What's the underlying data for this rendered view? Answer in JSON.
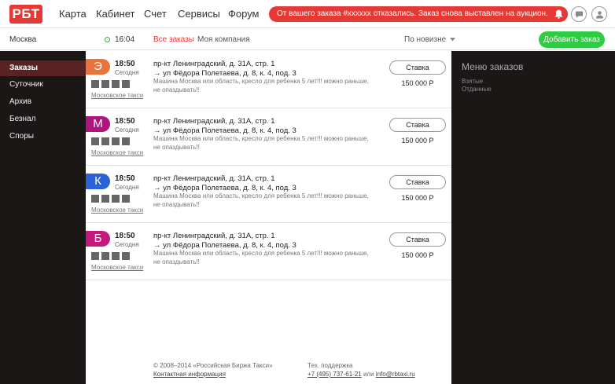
{
  "logo": "РБТ",
  "nav": [
    "Карта",
    "Кабинет",
    "Счет",
    "Сервисы",
    "Форум"
  ],
  "alert": "От вашего заказа #xxxxxx отказались. Заказ снова выставлен на аукцион.",
  "subbar": {
    "city": "Москва",
    "time": "16:04",
    "tab_all": "Все заказы",
    "tab_company": "Моя компания",
    "sort": "По новизне",
    "add_button": "Добавить заказ"
  },
  "sidebar": {
    "items": [
      {
        "label": "Заказы"
      },
      {
        "label": "Суточник"
      },
      {
        "label": "Архив"
      },
      {
        "label": "Безнал"
      },
      {
        "label": "Споры"
      }
    ]
  },
  "orders": [
    {
      "letter": "Э",
      "color": "#e8743b",
      "time": "18:50",
      "day": "Сегодня",
      "company": "Московское такси",
      "from": "пр-кт Ленинградский, д. 31А, стр. 1",
      "to": "→ ул Фёдора Полетаева, д. 8, к. 4, под. 3",
      "note": "Машина Москва или область, кресло для ребенка 5 лет!!! можно раньше, не опаздывать!!",
      "bid": "Ставка",
      "price": "150 000 Р"
    },
    {
      "letter": "М",
      "color": "#b0157e",
      "time": "18:50",
      "day": "Сегодня",
      "company": "Московское такси",
      "from": "пр-кт Ленинградский, д. 31А, стр. 1",
      "to": "→ ул Фёдора Полетаева, д. 8, к. 4, под. 3",
      "note": "Машина Москва или область, кресло для ребенка 5 лет!!! можно раньше, не опаздывать!!",
      "bid": "Ставка",
      "price": "150 000 Р"
    },
    {
      "letter": "К",
      "color": "#2a63d6",
      "time": "18:50",
      "day": "Сегодня",
      "company": "Московское такси",
      "from": "пр-кт Ленинградский, д. 31А, стр. 1",
      "to": "→ ул Фёдора Полетаева, д. 8, к. 4, под. 3",
      "note": "Машина Москва или область, кресло для ребенка 5 лет!!! можно раньше, не опаздывать!!",
      "bid": "Ставка",
      "price": "150 000 Р"
    },
    {
      "letter": "Б",
      "color": "#c4197d",
      "time": "18:50",
      "day": "Сегодня",
      "company": "Московское такси",
      "from": "пр-кт Ленинградский, д. 31А, стр. 1",
      "to": "→ ул Фёдора Полетаева, д. 8, к. 4, под. 3",
      "note": "Машина Москва или область, кресло для ребенка 5 лет!!! можно раньше, не опаздывать!!",
      "bid": "Ставка",
      "price": "150 000 Р"
    }
  ],
  "right_panel": {
    "title": "Меню заказов",
    "items": [
      "Взятые",
      "Отданные"
    ]
  },
  "footer": {
    "copyright": "© 2008–2014 «Российская Биржа Такси»",
    "contacts": "Контактная информация",
    "support": "Тех. поддержка",
    "phone": "+7 (495) 737-61-21",
    "or": "или",
    "email": "info@rbtaxi.ru"
  },
  "colors": {
    "accent": "#e53935",
    "green": "#2ecc40",
    "dark": "#1b1717",
    "active": "#5a2222"
  }
}
